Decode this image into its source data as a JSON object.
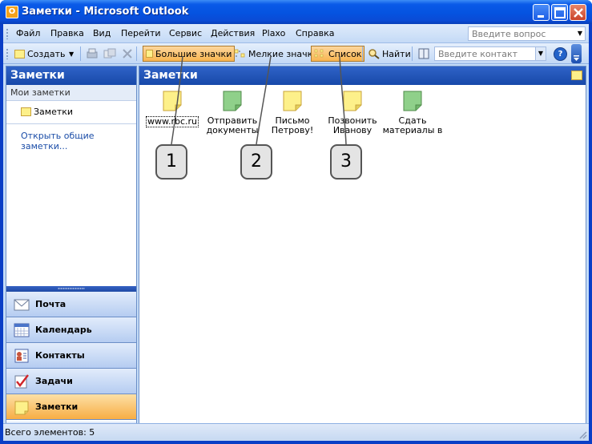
{
  "window": {
    "title": "Заметки - Microsoft Outlook",
    "icon_label": "O"
  },
  "menu": {
    "items": [
      "Файл",
      "Правка",
      "Вид",
      "Перейти",
      "Сервис",
      "Действия",
      "Plaxo",
      "Справка"
    ],
    "ask_placeholder": "Введите вопрос"
  },
  "toolbar": {
    "create_label": "Создать",
    "large_icons_label": "Большие значки",
    "small_icons_label": "Мелкие значки",
    "list_label": "Список",
    "find_label": "Найти",
    "contact_placeholder": "Введите контакт",
    "help_label": "?"
  },
  "nav": {
    "header": "Заметки",
    "section_label": "Мои заметки",
    "folder_label": "Заметки",
    "shared_link": "Открыть общие заметки...",
    "buttons": [
      {
        "label": "Почта",
        "icon": "mail-icon"
      },
      {
        "label": "Календарь",
        "icon": "calendar-icon"
      },
      {
        "label": "Контакты",
        "icon": "contacts-icon"
      },
      {
        "label": "Задачи",
        "icon": "tasks-icon"
      },
      {
        "label": "Заметки",
        "icon": "notes-icon",
        "active": true
      }
    ]
  },
  "content": {
    "header": "Заметки",
    "notes": [
      {
        "line1": "www.rbc.ru",
        "line2": "",
        "color": "#fdf08a"
      },
      {
        "line1": "Отправить",
        "line2": "документы",
        "color": "#8fd08a"
      },
      {
        "line1": "Письмо",
        "line2": "Петрову!",
        "color": "#fdf08a"
      },
      {
        "line1": "Позвонить",
        "line2": "Иванову",
        "color": "#fdf08a"
      },
      {
        "line1": "Сдать",
        "line2": "материалы в",
        "color": "#8fd08a"
      }
    ]
  },
  "callouts": [
    "1",
    "2",
    "3"
  ],
  "status": {
    "text": "Всего элементов: 5"
  }
}
